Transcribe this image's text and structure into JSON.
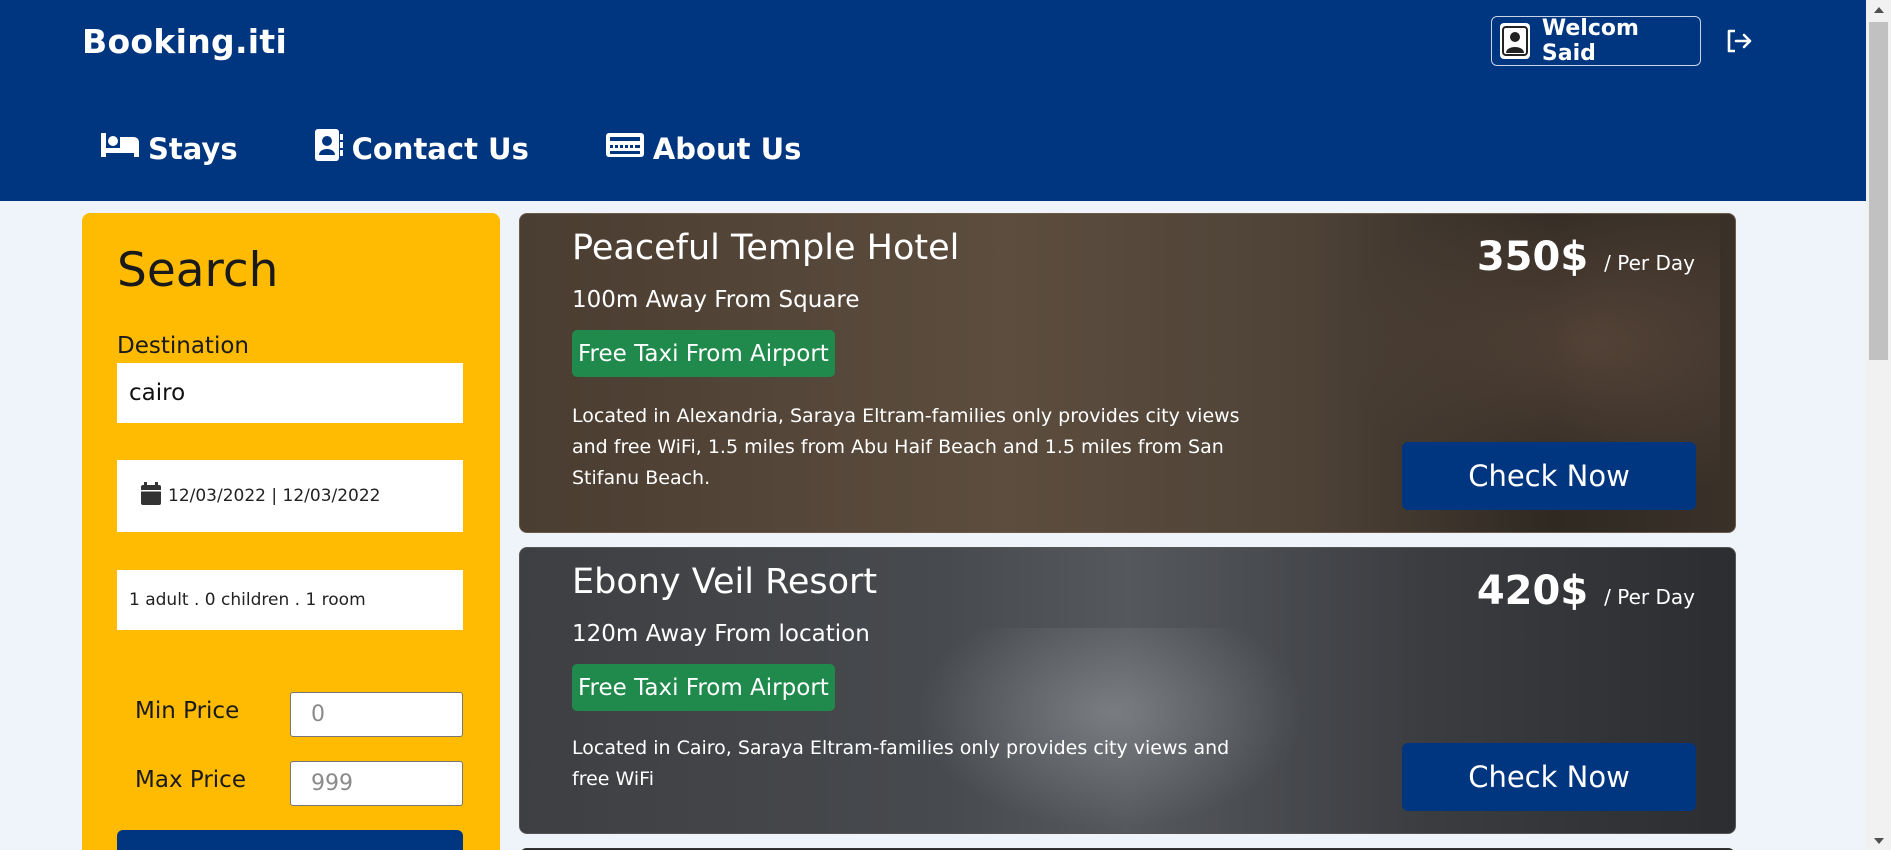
{
  "header": {
    "brand": "Booking.iti",
    "welcome": "Welcom Said",
    "icons": {
      "user": "user-icon",
      "logout": "logout-icon"
    }
  },
  "nav": {
    "items": [
      {
        "label": "Stays",
        "icon": "bed-icon"
      },
      {
        "label": "Contact Us",
        "icon": "contact-card-icon"
      },
      {
        "label": "About Us",
        "icon": "keyboard-icon"
      }
    ]
  },
  "search": {
    "title": "Search",
    "destination_label": "Destination",
    "destination_value": "cairo",
    "dates": "12/03/2022 | 12/03/2022",
    "guests": "1 adult . 0 children . 1 room",
    "min_price_label": "Min Price",
    "min_price_placeholder": "0",
    "max_price_label": "Max Price",
    "max_price_placeholder": "999"
  },
  "hotels": [
    {
      "name": "Peaceful Temple Hotel",
      "distance": "100m Away From Square",
      "badge": "Free Taxi From Airport",
      "description": "Located in Alexandria, Saraya Eltram-families only provides city views and free WiFi, 1.5 miles from Abu Haif Beach and 1.5 miles from San Stifanu Beach.",
      "price": "350$",
      "per": "/ Per Day",
      "button": "Check Now"
    },
    {
      "name": "Ebony Veil Resort",
      "distance": "120m Away From location",
      "badge": "Free Taxi From Airport",
      "description": "Located in Cairo, Saraya Eltram-families only provides city views and free WiFi",
      "price": "420$",
      "per": "/ Per Day",
      "button": "Check Now"
    }
  ],
  "colors": {
    "brand_blue": "#003580",
    "accent_yellow": "#febb02",
    "badge_green": "#1f8a4c"
  }
}
